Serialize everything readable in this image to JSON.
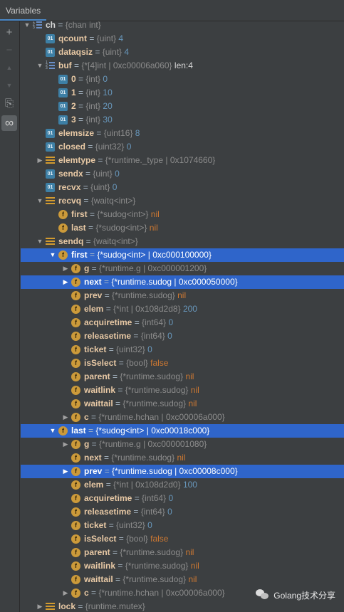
{
  "header": {
    "title": "Variables"
  },
  "toolbar": {
    "buttons": [
      {
        "label": "+",
        "name": "add-watch-icon"
      },
      {
        "label": "−",
        "name": "remove-watch-icon"
      },
      {
        "label": "▲",
        "name": "move-up-icon"
      },
      {
        "label": "▼",
        "name": "move-down-icon"
      },
      {
        "label": "⎘",
        "name": "copy-icon"
      },
      {
        "label": "∞",
        "name": "glasses-icon"
      }
    ]
  },
  "tree": [
    {
      "depth": 0,
      "arrow": "open",
      "icon": "list",
      "name": "ch",
      "eq": " = ",
      "type": "{chan int}",
      "value": "",
      "sel": false,
      "partial": true
    },
    {
      "depth": 1,
      "arrow": "",
      "icon": "01",
      "name": "qcount",
      "eq": " = ",
      "type": "{uint}",
      "value": "4",
      "sel": false
    },
    {
      "depth": 1,
      "arrow": "",
      "icon": "01",
      "name": "dataqsiz",
      "eq": " = ",
      "type": "{uint}",
      "value": "4",
      "sel": false
    },
    {
      "depth": 1,
      "arrow": "open",
      "icon": "list",
      "name": "buf",
      "eq": " = ",
      "type": "{*[4]int | 0xc00006a060}",
      "value": "len:4",
      "sel": false,
      "plainval": true
    },
    {
      "depth": 2,
      "arrow": "",
      "icon": "01",
      "name": "0",
      "eq": " = ",
      "type": "{int}",
      "value": "0",
      "sel": false
    },
    {
      "depth": 2,
      "arrow": "",
      "icon": "01",
      "name": "1",
      "eq": " = ",
      "type": "{int}",
      "value": "10",
      "sel": false
    },
    {
      "depth": 2,
      "arrow": "",
      "icon": "01",
      "name": "2",
      "eq": " = ",
      "type": "{int}",
      "value": "20",
      "sel": false
    },
    {
      "depth": 2,
      "arrow": "",
      "icon": "01",
      "name": "3",
      "eq": " = ",
      "type": "{int}",
      "value": "30",
      "sel": false
    },
    {
      "depth": 1,
      "arrow": "",
      "icon": "01",
      "name": "elemsize",
      "eq": " = ",
      "type": "{uint16}",
      "value": "8",
      "sel": false
    },
    {
      "depth": 1,
      "arrow": "",
      "icon": "01",
      "name": "closed",
      "eq": " = ",
      "type": "{uint32}",
      "value": "0",
      "sel": false
    },
    {
      "depth": 1,
      "arrow": "closed",
      "icon": "bars",
      "name": "elemtype",
      "eq": " = ",
      "type": "{*runtime._type | 0x1074660}",
      "value": "",
      "sel": false
    },
    {
      "depth": 1,
      "arrow": "",
      "icon": "01",
      "name": "sendx",
      "eq": " = ",
      "type": "{uint}",
      "value": "0",
      "sel": false
    },
    {
      "depth": 1,
      "arrow": "",
      "icon": "01",
      "name": "recvx",
      "eq": " = ",
      "type": "{uint}",
      "value": "0",
      "sel": false
    },
    {
      "depth": 1,
      "arrow": "open",
      "icon": "bars",
      "name": "recvq",
      "eq": " = ",
      "type": "{waitq<int>}",
      "value": "",
      "sel": false
    },
    {
      "depth": 2,
      "arrow": "",
      "icon": "f",
      "name": "first",
      "eq": " = ",
      "type": "{*sudog<int>}",
      "value": "nil",
      "sel": false,
      "kw": true
    },
    {
      "depth": 2,
      "arrow": "",
      "icon": "f",
      "name": "last",
      "eq": " = ",
      "type": "{*sudog<int>}",
      "value": "nil",
      "sel": false,
      "kw": true
    },
    {
      "depth": 1,
      "arrow": "open",
      "icon": "bars",
      "name": "sendq",
      "eq": " = ",
      "type": "{waitq<int>}",
      "value": "",
      "sel": false
    },
    {
      "depth": 2,
      "arrow": "open",
      "icon": "f",
      "name": "first",
      "eq": " = ",
      "type": "{*sudog<int> | 0xc000100000}",
      "value": "",
      "sel": true
    },
    {
      "depth": 3,
      "arrow": "closed",
      "icon": "f",
      "name": "g",
      "eq": " = ",
      "type": "{*runtime.g | 0xc000001200}",
      "value": "",
      "sel": false
    },
    {
      "depth": 3,
      "arrow": "closed",
      "icon": "f",
      "name": "next",
      "eq": " = ",
      "type": "{*runtime.sudog | 0xc000050000}",
      "value": "",
      "sel": true
    },
    {
      "depth": 3,
      "arrow": "",
      "icon": "f",
      "name": "prev",
      "eq": " = ",
      "type": "{*runtime.sudog}",
      "value": "nil",
      "sel": false,
      "kw": true
    },
    {
      "depth": 3,
      "arrow": "",
      "icon": "f",
      "name": "elem",
      "eq": " = ",
      "type": "{*int | 0x108d2d8}",
      "value": "200",
      "sel": false
    },
    {
      "depth": 3,
      "arrow": "",
      "icon": "f",
      "name": "acquiretime",
      "eq": " = ",
      "type": "{int64}",
      "value": "0",
      "sel": false
    },
    {
      "depth": 3,
      "arrow": "",
      "icon": "f",
      "name": "releasetime",
      "eq": " = ",
      "type": "{int64}",
      "value": "0",
      "sel": false
    },
    {
      "depth": 3,
      "arrow": "",
      "icon": "f",
      "name": "ticket",
      "eq": " = ",
      "type": "{uint32}",
      "value": "0",
      "sel": false
    },
    {
      "depth": 3,
      "arrow": "",
      "icon": "f",
      "name": "isSelect",
      "eq": " = ",
      "type": "{bool}",
      "value": "false",
      "sel": false,
      "kw": true
    },
    {
      "depth": 3,
      "arrow": "",
      "icon": "f",
      "name": "parent",
      "eq": " = ",
      "type": "{*runtime.sudog}",
      "value": "nil",
      "sel": false,
      "kw": true
    },
    {
      "depth": 3,
      "arrow": "",
      "icon": "f",
      "name": "waitlink",
      "eq": " = ",
      "type": "{*runtime.sudog}",
      "value": "nil",
      "sel": false,
      "kw": true
    },
    {
      "depth": 3,
      "arrow": "",
      "icon": "f",
      "name": "waittail",
      "eq": " = ",
      "type": "{*runtime.sudog}",
      "value": "nil",
      "sel": false,
      "kw": true
    },
    {
      "depth": 3,
      "arrow": "closed",
      "icon": "f",
      "name": "c",
      "eq": " = ",
      "type": "{*runtime.hchan | 0xc00006a000}",
      "value": "",
      "sel": false
    },
    {
      "depth": 2,
      "arrow": "open",
      "icon": "f",
      "name": "last",
      "eq": " = ",
      "type": "{*sudog<int> | 0xc00018c000}",
      "value": "",
      "sel": true
    },
    {
      "depth": 3,
      "arrow": "closed",
      "icon": "f",
      "name": "g",
      "eq": " = ",
      "type": "{*runtime.g | 0xc000001080}",
      "value": "",
      "sel": false
    },
    {
      "depth": 3,
      "arrow": "",
      "icon": "f",
      "name": "next",
      "eq": " = ",
      "type": "{*runtime.sudog}",
      "value": "nil",
      "sel": false,
      "kw": true
    },
    {
      "depth": 3,
      "arrow": "closed",
      "icon": "f",
      "name": "prev",
      "eq": " = ",
      "type": "{*runtime.sudog | 0xc00008c000}",
      "value": "",
      "sel": true
    },
    {
      "depth": 3,
      "arrow": "",
      "icon": "f",
      "name": "elem",
      "eq": " = ",
      "type": "{*int | 0x108d2d0}",
      "value": "100",
      "sel": false
    },
    {
      "depth": 3,
      "arrow": "",
      "icon": "f",
      "name": "acquiretime",
      "eq": " = ",
      "type": "{int64}",
      "value": "0",
      "sel": false
    },
    {
      "depth": 3,
      "arrow": "",
      "icon": "f",
      "name": "releasetime",
      "eq": " = ",
      "type": "{int64}",
      "value": "0",
      "sel": false
    },
    {
      "depth": 3,
      "arrow": "",
      "icon": "f",
      "name": "ticket",
      "eq": " = ",
      "type": "{uint32}",
      "value": "0",
      "sel": false
    },
    {
      "depth": 3,
      "arrow": "",
      "icon": "f",
      "name": "isSelect",
      "eq": " = ",
      "type": "{bool}",
      "value": "false",
      "sel": false,
      "kw": true
    },
    {
      "depth": 3,
      "arrow": "",
      "icon": "f",
      "name": "parent",
      "eq": " = ",
      "type": "{*runtime.sudog}",
      "value": "nil",
      "sel": false,
      "kw": true
    },
    {
      "depth": 3,
      "arrow": "",
      "icon": "f",
      "name": "waitlink",
      "eq": " = ",
      "type": "{*runtime.sudog}",
      "value": "nil",
      "sel": false,
      "kw": true
    },
    {
      "depth": 3,
      "arrow": "",
      "icon": "f",
      "name": "waittail",
      "eq": " = ",
      "type": "{*runtime.sudog}",
      "value": "nil",
      "sel": false,
      "kw": true
    },
    {
      "depth": 3,
      "arrow": "closed",
      "icon": "f",
      "name": "c",
      "eq": " = ",
      "type": "{*runtime.hchan | 0xc00006a000}",
      "value": "",
      "sel": false
    },
    {
      "depth": 1,
      "arrow": "closed",
      "icon": "bars",
      "name": "lock",
      "eq": " = ",
      "type": "{runtime.mutex}",
      "value": "",
      "sel": false
    }
  ],
  "watermark": {
    "text": "Golang技术分享",
    "icon": "wechat-icon"
  }
}
